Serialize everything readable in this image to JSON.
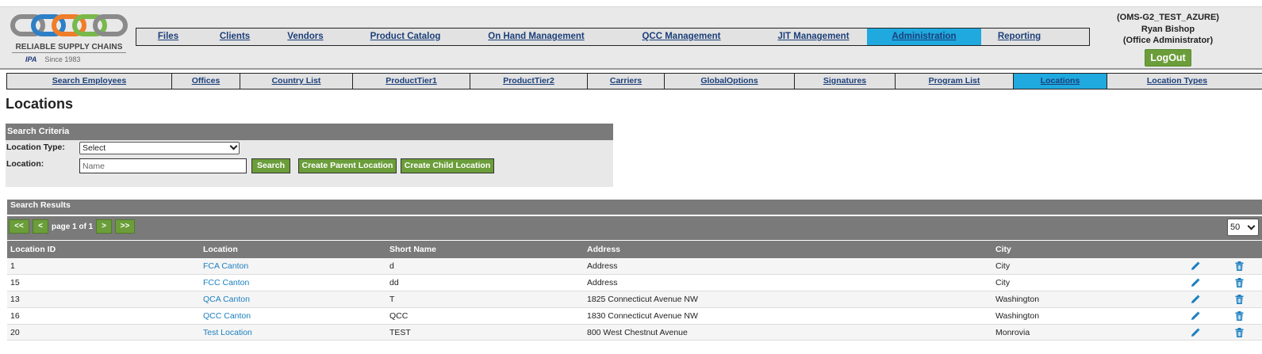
{
  "brand": {
    "name": "RELIABLE SUPPLY CHAINS",
    "powered": "IPA",
    "since": "Since 1983",
    "colors": [
      "#2d7fc6",
      "#f07d2a",
      "#79b84a",
      "#8a8a8a"
    ]
  },
  "main_nav": [
    {
      "label": "Files",
      "width": 80
    },
    {
      "label": "Clients",
      "width": 88
    },
    {
      "label": "Vendors",
      "width": 90
    },
    {
      "label": "Product Catalog",
      "width": 162
    },
    {
      "label": "On Hand Management",
      "width": 168
    },
    {
      "label": "QCC Management",
      "width": 198
    },
    {
      "label": "JIT Management",
      "width": 135
    },
    {
      "label": "Administration",
      "width": 144,
      "active": true
    },
    {
      "label": "Reporting",
      "width": 96
    }
  ],
  "user": {
    "env": "(OMS-G2_TEST_AZURE)",
    "name": "Ryan Bishop",
    "role": "(Office Administrator)",
    "logout": "LogOut"
  },
  "sub_nav": [
    {
      "label": "Search Employees",
      "width": 208
    },
    {
      "label": "Offices",
      "width": 86
    },
    {
      "label": "Country List",
      "width": 142
    },
    {
      "label": "ProductTier1",
      "width": 148
    },
    {
      "label": "ProductTier2",
      "width": 148
    },
    {
      "label": "Carriers",
      "width": 97
    },
    {
      "label": "GlobalOptions",
      "width": 164
    },
    {
      "label": "Signatures",
      "width": 127
    },
    {
      "label": "Program List",
      "width": 149
    },
    {
      "label": "Locations",
      "width": 118,
      "active": true
    },
    {
      "label": "Location Types",
      "width": 176
    }
  ],
  "page_title": "Locations",
  "search": {
    "header": "Search Criteria",
    "location_type_label": "Location Type:",
    "location_type_value": "Select",
    "location_label": "Location:",
    "location_placeholder": "Name",
    "search_btn": "Search",
    "create_parent_btn": "Create Parent Location",
    "create_child_btn": "Create Child Location"
  },
  "results": {
    "header": "Search Results",
    "first": "<<",
    "prev": "<",
    "page_info": "page 1 of 1",
    "next": ">",
    "last": ">>",
    "per_page": "50",
    "columns": [
      "Location ID",
      "Location",
      "Short Name",
      "Address",
      "City"
    ],
    "rows": [
      {
        "id": "1",
        "location": "FCA Canton",
        "short": "d",
        "address": "Address",
        "city": "City"
      },
      {
        "id": "15",
        "location": "FCC Canton",
        "short": "dd",
        "address": "Address",
        "city": "City"
      },
      {
        "id": "13",
        "location": "QCA Canton",
        "short": "T",
        "address": "1825 Connecticut Avenue NW",
        "city": "Washington"
      },
      {
        "id": "16",
        "location": "QCC Canton",
        "short": "QCC",
        "address": "1830 Connecticut Avenue NW",
        "city": "Washington"
      },
      {
        "id": "20",
        "location": "Test Location",
        "short": "TEST",
        "address": "800 West Chestnut Avenue",
        "city": "Monrovia"
      }
    ]
  },
  "icons": {
    "edit": "pencil-icon",
    "delete": "trash-icon",
    "accent": "#1c7fc0"
  }
}
